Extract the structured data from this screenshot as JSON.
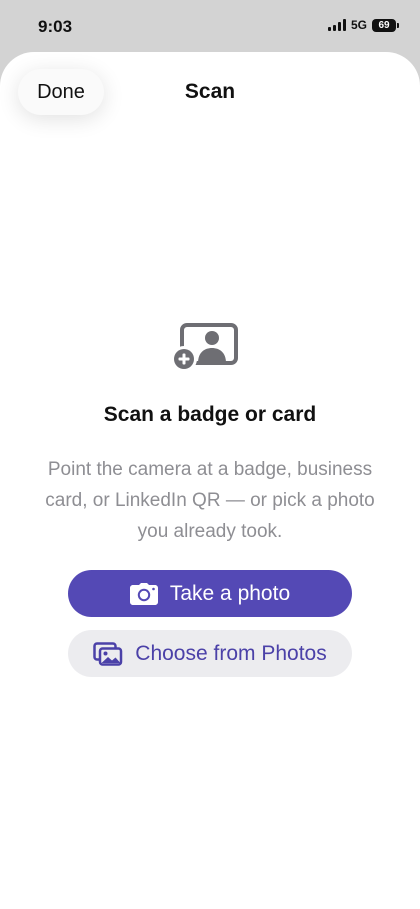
{
  "status_bar": {
    "time": "9:03",
    "network": "5G",
    "battery": "69"
  },
  "sheet": {
    "done_label": "Done",
    "title": "Scan"
  },
  "main": {
    "icon": "contact-card-add-icon",
    "heading": "Scan a badge or card",
    "description": "Point the camera at a badge, business card, or LinkedIn QR — or pick a photo you already took.",
    "primary_button": {
      "label": "Take a photo",
      "icon": "camera-icon"
    },
    "secondary_button": {
      "label": "Choose from Photos",
      "icon": "photos-icon"
    }
  },
  "colors": {
    "accent": "#5449b5",
    "accent_text": "#4b41a8",
    "secondary_bg": "#ececef",
    "muted_text": "#8e8e93",
    "icon_gray": "#6e6e73"
  }
}
